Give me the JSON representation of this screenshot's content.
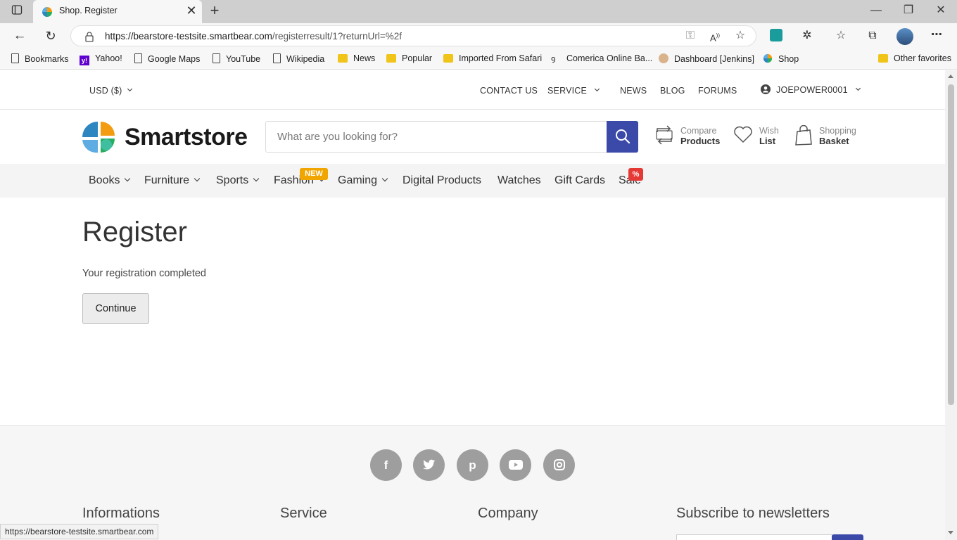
{
  "browser": {
    "tab_title": "Shop. Register",
    "url_host": "https://bearstore-testsite.smartbear.com",
    "url_path": "/registerresult/1?returnUrl=%2f",
    "bookmarks": [
      "Bookmarks",
      "Yahoo!",
      "Google Maps",
      "YouTube",
      "Wikipedia",
      "News",
      "Popular",
      "Imported From Safari",
      "Comerica Online Ba...",
      "Dashboard [Jenkins]",
      "Shop"
    ],
    "other_favorites": "Other favorites",
    "status_url": "https://bearstore-testsite.smartbear.com"
  },
  "topbar": {
    "currency": "USD  ($)",
    "contact": "CONTACT US",
    "service": "SERVICE",
    "news": "NEWS",
    "blog": "BLOG",
    "forums": "FORUMS",
    "user": "JOEPOWER0001"
  },
  "header": {
    "logo_text": "Smartstore",
    "search_placeholder": "What are you looking for?",
    "compare_l1": "Compare",
    "compare_l2": "Products",
    "wish_l1": "Wish",
    "wish_l2": "List",
    "basket_l1": "Shopping",
    "basket_l2": "Basket"
  },
  "categories": {
    "books": "Books",
    "furniture": "Furniture",
    "sports": "Sports",
    "fashion": "Fashion",
    "fashion_badge": "NEW",
    "gaming": "Gaming",
    "digital": "Digital Products",
    "watches": "Watches",
    "giftcards": "Gift Cards",
    "sale": "Sale",
    "sale_badge": "%"
  },
  "main": {
    "heading": "Register",
    "message": "Your registration completed",
    "continue_label": "Continue"
  },
  "footer": {
    "social": [
      "f",
      "t",
      "p",
      "y",
      "i"
    ],
    "informations": "Informations",
    "service": "Service",
    "company": "Company",
    "newsletter": "Subscribe to newsletters"
  },
  "colors": {
    "accent": "#3b4aa8",
    "badge_new": "#f0a500",
    "badge_sale": "#e53935"
  }
}
